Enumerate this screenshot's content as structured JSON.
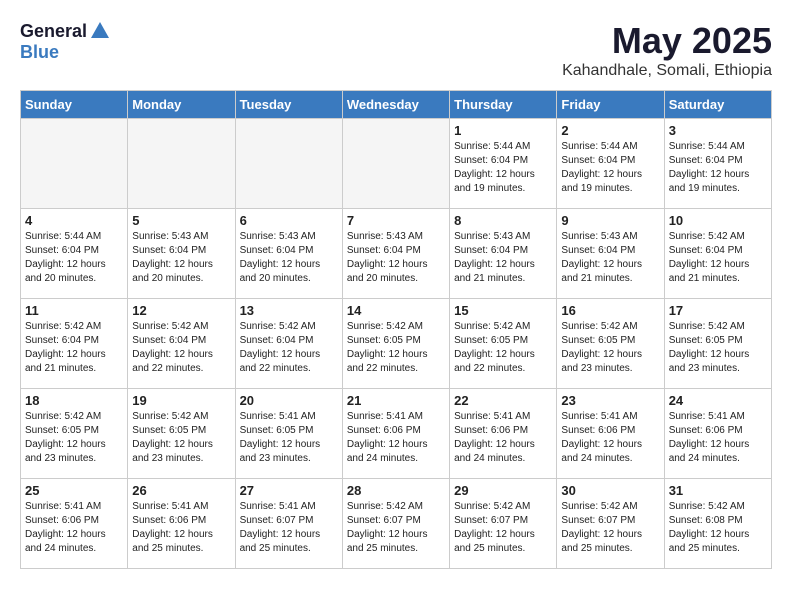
{
  "logo": {
    "general": "General",
    "blue": "Blue"
  },
  "title": "May 2025",
  "location": "Kahandhale, Somali, Ethiopia",
  "days_of_week": [
    "Sunday",
    "Monday",
    "Tuesday",
    "Wednesday",
    "Thursday",
    "Friday",
    "Saturday"
  ],
  "weeks": [
    [
      {
        "day": "",
        "empty": true
      },
      {
        "day": "",
        "empty": true
      },
      {
        "day": "",
        "empty": true
      },
      {
        "day": "",
        "empty": true
      },
      {
        "day": "1",
        "sunrise": "5:44 AM",
        "sunset": "6:04 PM",
        "daylight": "12 hours and 19 minutes."
      },
      {
        "day": "2",
        "sunrise": "5:44 AM",
        "sunset": "6:04 PM",
        "daylight": "12 hours and 19 minutes."
      },
      {
        "day": "3",
        "sunrise": "5:44 AM",
        "sunset": "6:04 PM",
        "daylight": "12 hours and 19 minutes."
      }
    ],
    [
      {
        "day": "4",
        "sunrise": "5:44 AM",
        "sunset": "6:04 PM",
        "daylight": "12 hours and 20 minutes."
      },
      {
        "day": "5",
        "sunrise": "5:43 AM",
        "sunset": "6:04 PM",
        "daylight": "12 hours and 20 minutes."
      },
      {
        "day": "6",
        "sunrise": "5:43 AM",
        "sunset": "6:04 PM",
        "daylight": "12 hours and 20 minutes."
      },
      {
        "day": "7",
        "sunrise": "5:43 AM",
        "sunset": "6:04 PM",
        "daylight": "12 hours and 20 minutes."
      },
      {
        "day": "8",
        "sunrise": "5:43 AM",
        "sunset": "6:04 PM",
        "daylight": "12 hours and 21 minutes."
      },
      {
        "day": "9",
        "sunrise": "5:43 AM",
        "sunset": "6:04 PM",
        "daylight": "12 hours and 21 minutes."
      },
      {
        "day": "10",
        "sunrise": "5:42 AM",
        "sunset": "6:04 PM",
        "daylight": "12 hours and 21 minutes."
      }
    ],
    [
      {
        "day": "11",
        "sunrise": "5:42 AM",
        "sunset": "6:04 PM",
        "daylight": "12 hours and 21 minutes."
      },
      {
        "day": "12",
        "sunrise": "5:42 AM",
        "sunset": "6:04 PM",
        "daylight": "12 hours and 22 minutes."
      },
      {
        "day": "13",
        "sunrise": "5:42 AM",
        "sunset": "6:04 PM",
        "daylight": "12 hours and 22 minutes."
      },
      {
        "day": "14",
        "sunrise": "5:42 AM",
        "sunset": "6:05 PM",
        "daylight": "12 hours and 22 minutes."
      },
      {
        "day": "15",
        "sunrise": "5:42 AM",
        "sunset": "6:05 PM",
        "daylight": "12 hours and 22 minutes."
      },
      {
        "day": "16",
        "sunrise": "5:42 AM",
        "sunset": "6:05 PM",
        "daylight": "12 hours and 23 minutes."
      },
      {
        "day": "17",
        "sunrise": "5:42 AM",
        "sunset": "6:05 PM",
        "daylight": "12 hours and 23 minutes."
      }
    ],
    [
      {
        "day": "18",
        "sunrise": "5:42 AM",
        "sunset": "6:05 PM",
        "daylight": "12 hours and 23 minutes."
      },
      {
        "day": "19",
        "sunrise": "5:42 AM",
        "sunset": "6:05 PM",
        "daylight": "12 hours and 23 minutes."
      },
      {
        "day": "20",
        "sunrise": "5:41 AM",
        "sunset": "6:05 PM",
        "daylight": "12 hours and 23 minutes."
      },
      {
        "day": "21",
        "sunrise": "5:41 AM",
        "sunset": "6:06 PM",
        "daylight": "12 hours and 24 minutes."
      },
      {
        "day": "22",
        "sunrise": "5:41 AM",
        "sunset": "6:06 PM",
        "daylight": "12 hours and 24 minutes."
      },
      {
        "day": "23",
        "sunrise": "5:41 AM",
        "sunset": "6:06 PM",
        "daylight": "12 hours and 24 minutes."
      },
      {
        "day": "24",
        "sunrise": "5:41 AM",
        "sunset": "6:06 PM",
        "daylight": "12 hours and 24 minutes."
      }
    ],
    [
      {
        "day": "25",
        "sunrise": "5:41 AM",
        "sunset": "6:06 PM",
        "daylight": "12 hours and 24 minutes."
      },
      {
        "day": "26",
        "sunrise": "5:41 AM",
        "sunset": "6:06 PM",
        "daylight": "12 hours and 25 minutes."
      },
      {
        "day": "27",
        "sunrise": "5:41 AM",
        "sunset": "6:07 PM",
        "daylight": "12 hours and 25 minutes."
      },
      {
        "day": "28",
        "sunrise": "5:42 AM",
        "sunset": "6:07 PM",
        "daylight": "12 hours and 25 minutes."
      },
      {
        "day": "29",
        "sunrise": "5:42 AM",
        "sunset": "6:07 PM",
        "daylight": "12 hours and 25 minutes."
      },
      {
        "day": "30",
        "sunrise": "5:42 AM",
        "sunset": "6:07 PM",
        "daylight": "12 hours and 25 minutes."
      },
      {
        "day": "31",
        "sunrise": "5:42 AM",
        "sunset": "6:08 PM",
        "daylight": "12 hours and 25 minutes."
      }
    ]
  ],
  "labels": {
    "sunrise": "Sunrise:",
    "sunset": "Sunset:",
    "daylight": "Daylight:"
  }
}
